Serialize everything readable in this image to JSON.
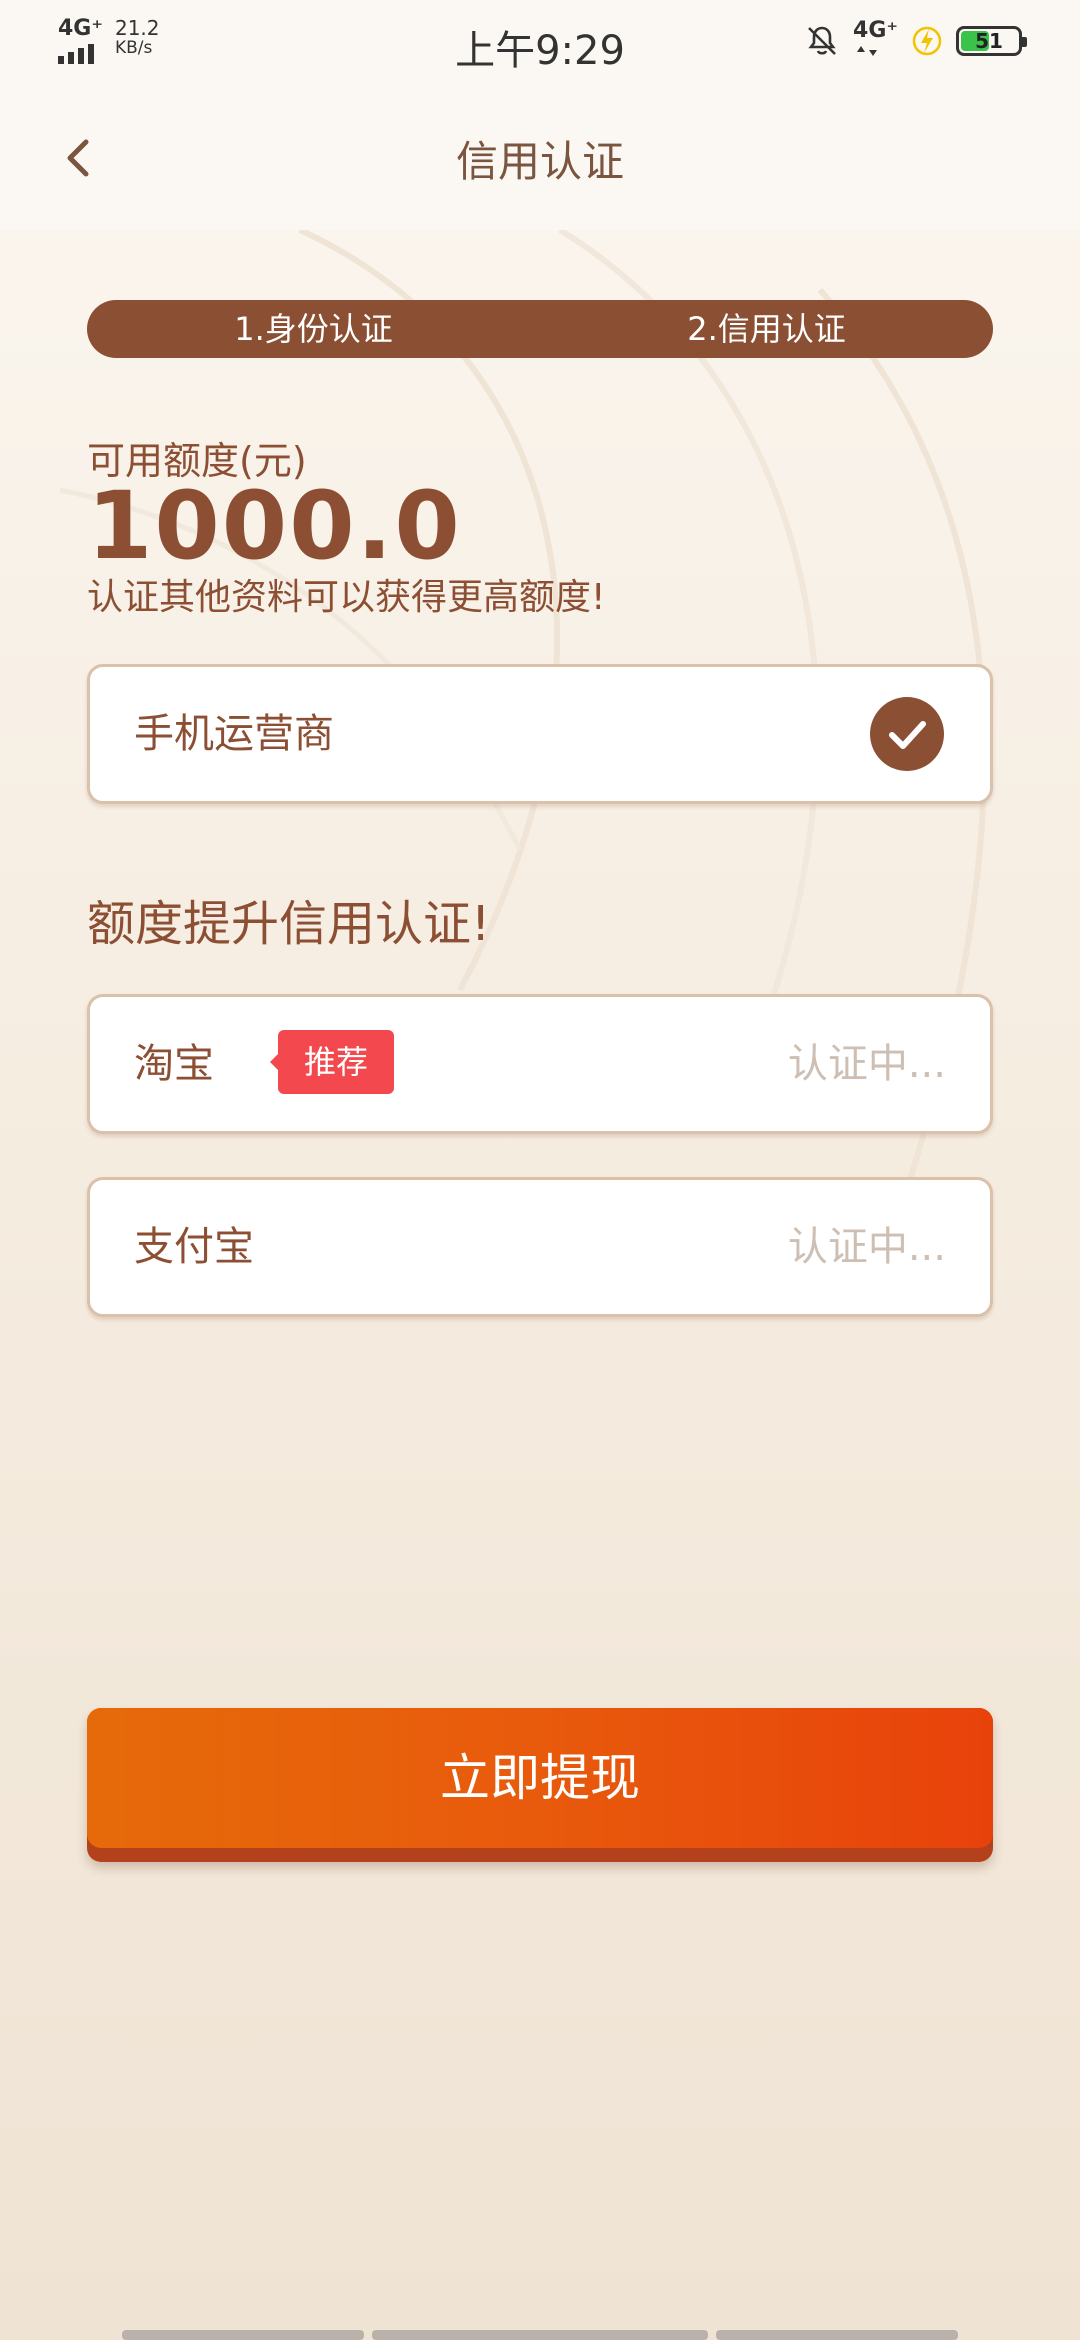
{
  "status_bar": {
    "network_left": "4G⁺",
    "speed_value": "21.2",
    "speed_unit": "KB/s",
    "time": "上午9:29",
    "network_right": "4G⁺",
    "battery_level": "51"
  },
  "nav": {
    "title": "信用认证"
  },
  "steps": [
    "1.身份认证",
    "2.信用认证"
  ],
  "quota": {
    "label": "可用额度(元)",
    "value": "1000.0",
    "tip": "认证其他资料可以获得更高额度!"
  },
  "carrier_card": {
    "label": "手机运营商"
  },
  "section_title": "额度提升信用认证!",
  "items": [
    {
      "label": "淘宝",
      "tag": "推荐",
      "status": "认证中..."
    },
    {
      "label": "支付宝",
      "status": "认证中..."
    }
  ],
  "cta_label": "立即提现",
  "colors": {
    "brand_brown": "#8b4f33",
    "cta_orange": "#e85a0c",
    "tag_red": "#f2484e",
    "muted": "#cdbfb3"
  }
}
